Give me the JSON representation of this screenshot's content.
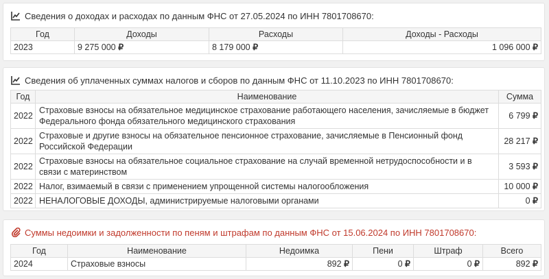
{
  "income": {
    "title": "Сведения о доходах и расходах по данным ФНС от 27.05.2024 по ИНН 7801708670:",
    "icon": "line-chart-icon",
    "headers": [
      "Год",
      "Доходы",
      "Расходы",
      "Доходы - Расходы"
    ],
    "rows": [
      {
        "year": "2023",
        "income": "9 275 000",
        "expenses": "8 179 000",
        "diff": "1 096 000"
      }
    ]
  },
  "taxes": {
    "title": "Сведения об уплаченных суммах налогов и сборов по данным ФНС от 11.10.2023 по ИНН 7801708670:",
    "icon": "line-chart-icon",
    "headers": [
      "Год",
      "Наименование",
      "Сумма"
    ],
    "rows": [
      {
        "year": "2022",
        "name": "Страховые взносы на обязательное медицинское страхование работающего населения, зачисляемые в бюджет Федерального фонда обязательного медицинского страхования",
        "sum": "6 799"
      },
      {
        "year": "2022",
        "name": "Страховые и другие взносы на обязательное пенсионное страхование, зачисляемые в Пенсионный фонд Российской Федерации",
        "sum": "28 217"
      },
      {
        "year": "2022",
        "name": "Страховые взносы на обязательное социальное страхование на случай временной нетрудоспособности и в связи с материнством",
        "sum": "3 593"
      },
      {
        "year": "2022",
        "name": "Налог, взимаемый в связи с применением упрощенной системы налогообложения",
        "sum": "10 000"
      },
      {
        "year": "2022",
        "name": "НЕНАЛОГОВЫЕ ДОХОДЫ, администрируемые налоговыми органами",
        "sum": "0"
      }
    ]
  },
  "arrears": {
    "title": "Суммы недоимки и задолженности по пеням и штрафам по данным ФНС от 15.06.2024 по ИНН 7801708670:",
    "icon": "paperclip-icon",
    "headers": [
      "Год",
      "Наименование",
      "Недоимка",
      "Пени",
      "Штраф",
      "Всего"
    ],
    "rows": [
      {
        "year": "2024",
        "name": "Страховые взносы",
        "arrear": "892",
        "penalty": "0",
        "fine": "0",
        "total": "892"
      }
    ]
  },
  "currency_symbol": "₽",
  "colors": {
    "title_red": "#c0392b",
    "header_bg": "#f5f5f5",
    "border": "#dcdcdc"
  }
}
